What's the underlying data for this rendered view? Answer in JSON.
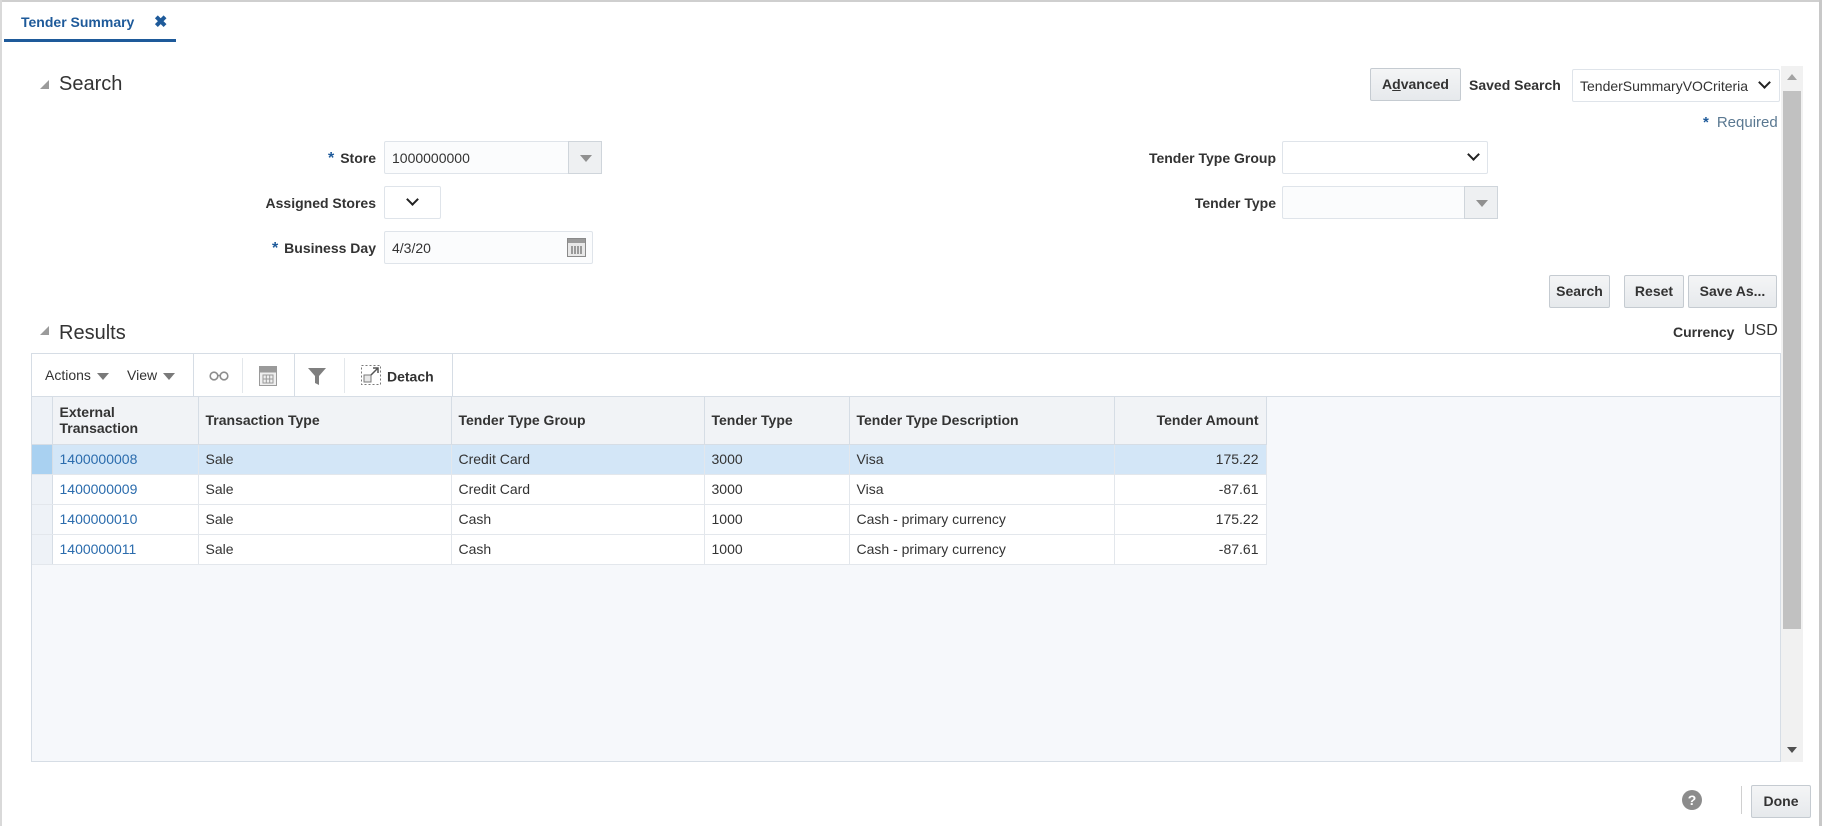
{
  "tab": {
    "label": "Tender Summary",
    "close_icon": "close-icon"
  },
  "search": {
    "title": "Search",
    "advanced_label": "Advanced",
    "saved_search_label": "Saved Search",
    "saved_search_value": "TenderSummaryVOCriteria",
    "required_note": "Required",
    "required_marker": "*",
    "fields": {
      "store": {
        "label": "Store",
        "value": "1000000000",
        "required": true
      },
      "assigned_stores": {
        "label": "Assigned Stores",
        "value": ""
      },
      "business_day": {
        "label": "Business Day",
        "value": "4/3/20",
        "required": true
      },
      "tender_type_group": {
        "label": "Tender Type Group",
        "value": ""
      },
      "tender_type": {
        "label": "Tender Type",
        "value": ""
      }
    },
    "buttons": {
      "search": "Search",
      "reset": "Reset",
      "save_as": "Save As..."
    }
  },
  "results": {
    "title": "Results",
    "currency_label": "Currency",
    "currency_value": "USD",
    "toolbar": {
      "actions": "Actions",
      "view": "View",
      "detach": "Detach",
      "icons": [
        "glasses-icon",
        "export-excel-icon",
        "filter-icon",
        "detach-icon"
      ]
    },
    "columns": [
      "External Transaction",
      "Transaction Type",
      "Tender Type Group",
      "Tender Type",
      "Tender Type Description",
      "Tender Amount"
    ],
    "rows": [
      {
        "external_transaction": "1400000008",
        "transaction_type": "Sale",
        "tender_type_group": "Credit Card",
        "tender_type": "3000",
        "description": "Visa",
        "amount": "175.22",
        "selected": true
      },
      {
        "external_transaction": "1400000009",
        "transaction_type": "Sale",
        "tender_type_group": "Credit Card",
        "tender_type": "3000",
        "description": "Visa",
        "amount": "-87.61",
        "selected": false
      },
      {
        "external_transaction": "1400000010",
        "transaction_type": "Sale",
        "tender_type_group": "Cash",
        "tender_type": "1000",
        "description": "Cash - primary currency",
        "amount": "175.22",
        "selected": false
      },
      {
        "external_transaction": "1400000011",
        "transaction_type": "Sale",
        "tender_type_group": "Cash",
        "tender_type": "1000",
        "description": "Cash - primary currency",
        "amount": "-87.61",
        "selected": false
      }
    ]
  },
  "footer": {
    "help_glyph": "?",
    "done_label": "Done"
  },
  "colors": {
    "accent": "#1e5a9a",
    "link": "#2b6cad",
    "selected_row": "#d3e6f7"
  }
}
